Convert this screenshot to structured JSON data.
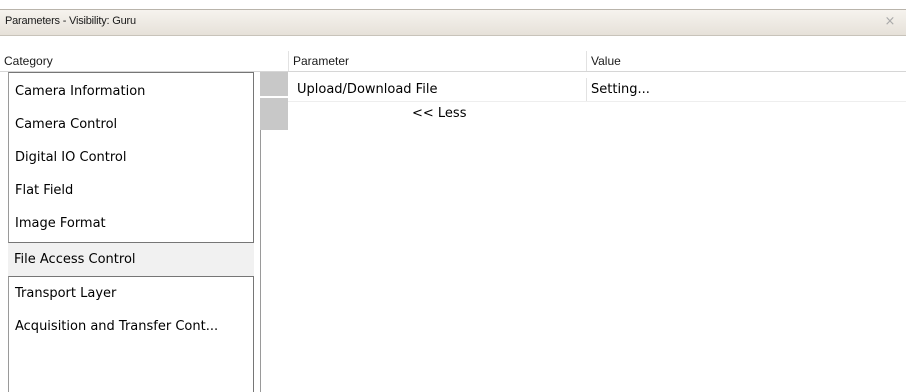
{
  "window": {
    "title": "Parameters - Visibility: Guru",
    "close_icon": "×"
  },
  "columns": {
    "category": "Category",
    "parameter": "Parameter",
    "value": "Value"
  },
  "categories": [
    {
      "label": "Camera Information",
      "selected": false
    },
    {
      "label": "Camera Control",
      "selected": false
    },
    {
      "label": "Digital IO Control",
      "selected": false
    },
    {
      "label": "Flat Field",
      "selected": false
    },
    {
      "label": "Image Format",
      "selected": false
    },
    {
      "label": "File Access Control",
      "selected": true
    },
    {
      "label": "Transport Layer",
      "selected": false
    },
    {
      "label": "Acquisition and Transfer Cont...",
      "selected": false
    }
  ],
  "parameters": [
    {
      "name": "Upload/Download File",
      "value": "Setting..."
    }
  ],
  "less_link": "<< Less",
  "colors": {
    "titlebar": "#ebe7e0",
    "selected_row": "#f1f1f1",
    "row_indicator": "#c8c8c8"
  }
}
